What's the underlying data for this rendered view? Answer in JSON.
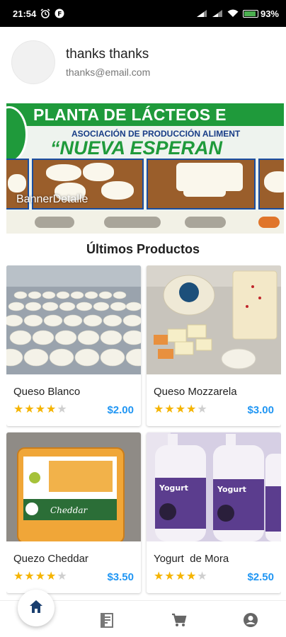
{
  "status_bar": {
    "time": "21:54",
    "battery_percent": "93%",
    "battery_level": 0.93
  },
  "profile": {
    "name": "thanks thanks",
    "email": "thanks@email.com"
  },
  "banner": {
    "headline": "PLANTA DE LÁCTEOS E",
    "subtitle": "ASOCIACIÓN DE PRODUCCIÓN ALIMENT",
    "quote": "“NUEVA ESPERAN",
    "label": "BannerDetalle"
  },
  "section_title": "Últimos Productos",
  "products": [
    {
      "name": "Queso Blanco",
      "price": "$2.00",
      "rating": 4,
      "max_rating": 5
    },
    {
      "name": "Queso Mozzarela",
      "price": "$3.00",
      "rating": 4,
      "max_rating": 5
    },
    {
      "name": "Quezo Cheddar",
      "price": "$3.50",
      "rating": 4,
      "max_rating": 5
    },
    {
      "name": "Yogurt  de Mora",
      "price": "$2.50",
      "rating": 4,
      "max_rating": 5
    }
  ],
  "bottom_nav": {
    "items": [
      "home-icon",
      "catalog-icon",
      "cart-icon",
      "account-icon"
    ],
    "active": "home-icon"
  },
  "colors": {
    "accent": "#1a3f6f",
    "price": "#2196f3",
    "star": "#f5b400",
    "banner_green": "#1f9a3b"
  }
}
